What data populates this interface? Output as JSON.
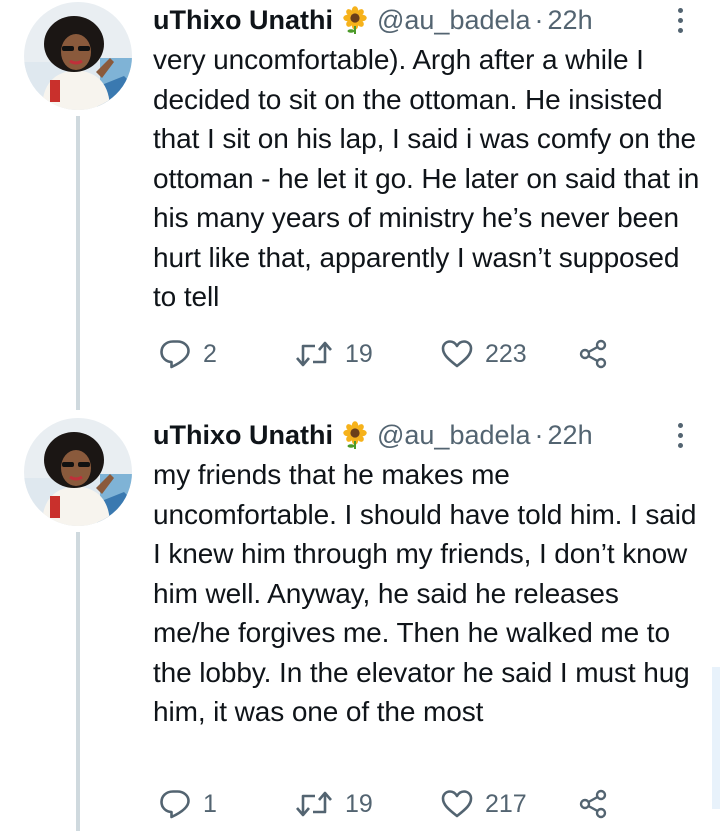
{
  "tweets": [
    {
      "display_name": "uThixo Unathi",
      "emoji": "sunflower-emoji",
      "handle": "@au_badela",
      "separator": "·",
      "time": "22h",
      "text": "very uncomfortable). Argh after a while I decided to sit on the ottoman. He insisted that I sit on his lap, I said i was comfy on the ottoman - he let it go. He later on said that in his many years of ministry he’s never been hurt like that, apparently I wasn’t supposed to tell",
      "replies": "2",
      "retweets": "19",
      "likes": "223"
    },
    {
      "display_name": "uThixo Unathi",
      "emoji": "sunflower-emoji",
      "handle": "@au_badela",
      "separator": "·",
      "time": "22h",
      "text": "my friends that he makes me uncomfortable. I should have told him. I said I knew him through my friends, I don’t know him well. Anyway, he said he releases me/he forgives me. Then he walked me to the lobby. In the elevator he said I must hug him, it was one of the most",
      "replies": "1",
      "retweets": "19",
      "likes": "217"
    }
  ],
  "icons": {
    "reply": "reply-icon",
    "retweet": "retweet-icon",
    "like": "heart-icon",
    "share": "share-icon",
    "more": "more-options-icon"
  },
  "colors": {
    "text": "#0f1419",
    "secondary": "#536471",
    "thread_line": "#cfd9de"
  }
}
